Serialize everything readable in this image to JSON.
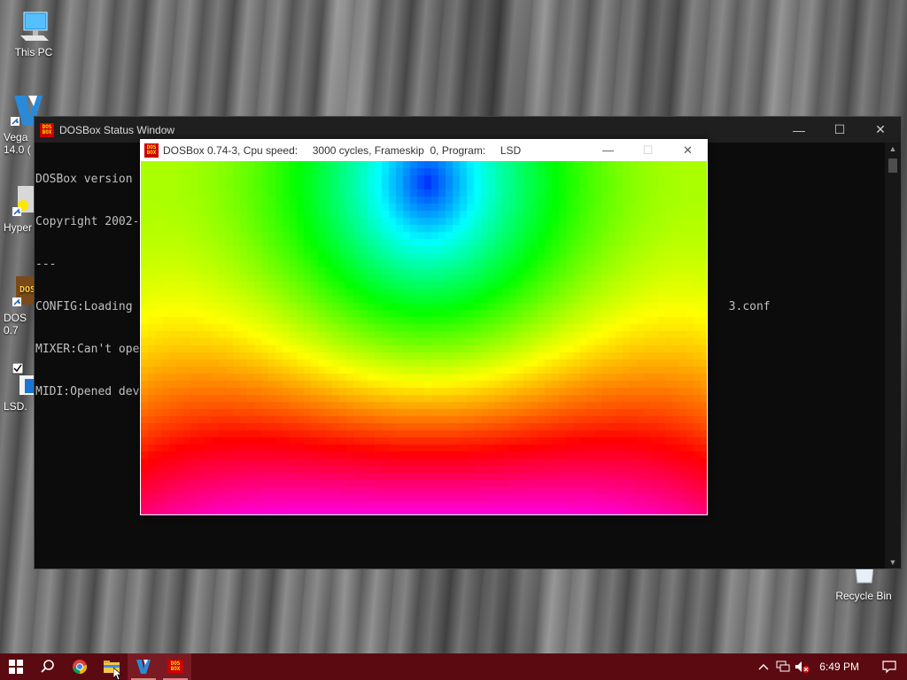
{
  "desktop": {
    "icons": [
      {
        "label": "This PC",
        "icon": "computer-icon"
      },
      {
        "label": "Vega\n14.0 (",
        "icon": "vegas-icon"
      },
      {
        "label": "Hyper",
        "icon": "hypercam-icon"
      },
      {
        "label": "DOS\n0.7",
        "icon": "dosbox-icon"
      },
      {
        "label": "LSD.",
        "icon": "file-icon"
      },
      {
        "label": "Recycle Bin",
        "icon": "recycle-bin-icon"
      }
    ]
  },
  "status_window": {
    "title": "DOSBox Status Window",
    "console_lines": [
      "DOSBox version",
      "Copyright 2002-",
      "---",
      "CONFIG:Loading                                                                                      3.conf",
      "MIXER:Can't ope",
      "MIDI:Opened dev"
    ],
    "minimize": "—",
    "maximize": "☐",
    "close": "✕"
  },
  "dos_window": {
    "title": "DOSBox 0.74-3, Cpu speed:     3000 cycles, Frameskip  0, Program:     LSD",
    "minimize": "—",
    "maximize": "☐",
    "close": "✕",
    "badge_top": "DOS",
    "badge_bottom": "BOX"
  },
  "taskbar": {
    "items": [
      {
        "name": "start",
        "icon": "windows-icon"
      },
      {
        "name": "search",
        "icon": "search-icon"
      },
      {
        "name": "chrome",
        "icon": "chrome-icon"
      },
      {
        "name": "file-explorer",
        "icon": "folder-icon"
      },
      {
        "name": "vegas",
        "icon": "vegas-icon"
      },
      {
        "name": "dosbox",
        "icon": "dosbox-icon"
      }
    ],
    "clock": "6:49 PM"
  },
  "colors": {
    "taskbar": "#5a0a10",
    "dosbox_red": "#cc0000",
    "dosbox_yellow": "#ffde00"
  }
}
